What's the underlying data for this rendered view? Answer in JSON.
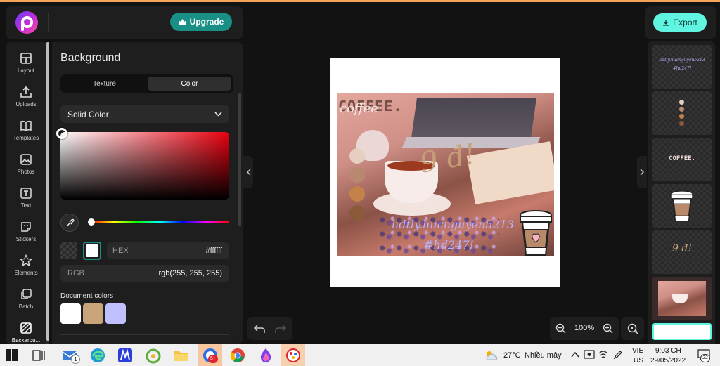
{
  "header": {
    "upgrade_label": "Upgrade",
    "export_label": "Export"
  },
  "tools": [
    {
      "label": "Layout",
      "icon": "layout-icon"
    },
    {
      "label": "Uploads",
      "icon": "upload-icon"
    },
    {
      "label": "Templates",
      "icon": "templates-icon"
    },
    {
      "label": "Photos",
      "icon": "photos-icon"
    },
    {
      "label": "Text",
      "icon": "text-icon"
    },
    {
      "label": "Stickers",
      "icon": "stickers-icon"
    },
    {
      "label": "Elements",
      "icon": "elements-icon"
    },
    {
      "label": "Batch",
      "icon": "batch-icon"
    },
    {
      "label": "Backarou...",
      "icon": "background-icon"
    }
  ],
  "panel": {
    "title": "Background",
    "tab_texture": "Texture",
    "tab_color": "Color",
    "fill_type": "Solid Color",
    "hex_label": "HEX",
    "hex_value": "#ffffff",
    "rgb_label": "RGB",
    "rgb_value": "rgb(255, 255, 255)",
    "doc_colors_title": "Document colors",
    "doc_colors": [
      "#ffffff",
      "#c9a47a",
      "#c0c0ff"
    ]
  },
  "canvas": {
    "title_text": "COFFEE.",
    "script_text": "coffee",
    "price_text": "9 đ!",
    "handle_text": "hdtly.hucnguyen5213",
    "tag_text": "#hd247!",
    "palette": [
      "#e6cfc0",
      "#b8896e",
      "#c4824a",
      "#8a5a3b"
    ]
  },
  "zoom": {
    "level": "100%"
  },
  "pages": {
    "thumb_handle": "hdtly.hucnguyen5213",
    "thumb_tag": "#hd247!",
    "thumb_coffee": "COFFEE.",
    "thumb_price": "9 đ!"
  },
  "taskbar": {
    "weather_temp": "27°C",
    "weather_desc": "Nhiều mây",
    "lang_top": "VIE",
    "lang_bottom": "US",
    "time": "9:03 CH",
    "date": "29/05/2022",
    "notif_count": "22",
    "mail_badge": "1",
    "zalo_badge": "5+"
  },
  "colors": {
    "accent_teal": "#1a8f86",
    "export_mint": "#5ff5e0",
    "app_bg": "#121212",
    "panel_bg": "#1e1e1e"
  }
}
